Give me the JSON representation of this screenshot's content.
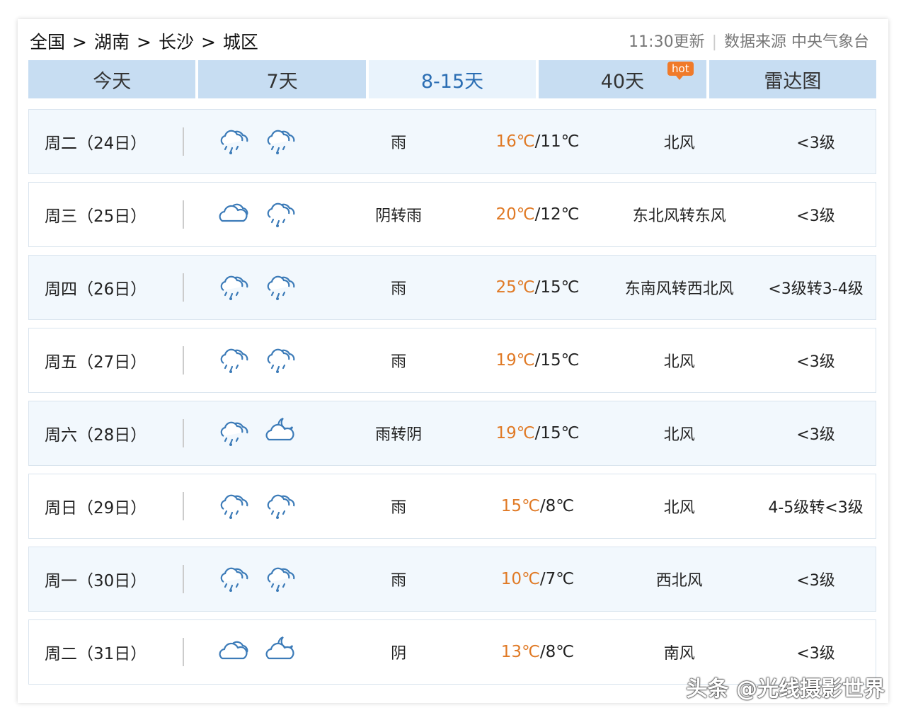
{
  "breadcrumb": {
    "items": [
      "全国",
      "湖南",
      "长沙",
      "城区"
    ],
    "separator": ">"
  },
  "source": {
    "update": "11:30更新",
    "divider": "|",
    "text": "数据来源 中央气象台"
  },
  "tabs": [
    {
      "label": "今天",
      "active": false
    },
    {
      "label": "7天",
      "active": false
    },
    {
      "label": "8-15天",
      "active": true
    },
    {
      "label": "40天",
      "active": false,
      "badge": "hot"
    },
    {
      "label": "雷达图",
      "active": false
    }
  ],
  "colors": {
    "tab_bg": "#c7ddf2",
    "tab_active_bg": "#e9f3fc",
    "tab_active_text": "#2a6db3",
    "high_temp": "#e07a26",
    "row_alt_bg": "#f2f8fd",
    "hot_badge": "#f07a2a",
    "icon": "#3c7bb8"
  },
  "forecast": [
    {
      "day": "周二（24日）",
      "icons": [
        "rain-cloud-icon",
        "rain-cloud-icon"
      ],
      "condition": "雨",
      "high": "16℃",
      "low": "11℃",
      "wind": "北风",
      "level": "<3级"
    },
    {
      "day": "周三（25日）",
      "icons": [
        "cloudy-icon",
        "rain-cloud-icon"
      ],
      "condition": "阴转雨",
      "high": "20℃",
      "low": "12℃",
      "wind": "东北风转东风",
      "level": "<3级"
    },
    {
      "day": "周四（26日）",
      "icons": [
        "rain-cloud-icon",
        "rain-cloud-icon"
      ],
      "condition": "雨",
      "high": "25℃",
      "low": "15℃",
      "wind": "东南风转西北风",
      "level": "<3级转3-4级"
    },
    {
      "day": "周五（27日）",
      "icons": [
        "rain-cloud-icon",
        "rain-cloud-icon"
      ],
      "condition": "雨",
      "high": "19℃",
      "low": "15℃",
      "wind": "北风",
      "level": "<3级"
    },
    {
      "day": "周六（28日）",
      "icons": [
        "rain-cloud-icon",
        "moon-cloud-icon"
      ],
      "condition": "雨转阴",
      "high": "19℃",
      "low": "15℃",
      "wind": "北风",
      "level": "<3级"
    },
    {
      "day": "周日（29日）",
      "icons": [
        "rain-cloud-icon",
        "rain-cloud-icon"
      ],
      "condition": "雨",
      "high": "15℃",
      "low": "8℃",
      "wind": "北风",
      "level": "4-5级转<3级"
    },
    {
      "day": "周一（30日）",
      "icons": [
        "rain-cloud-icon",
        "rain-cloud-icon"
      ],
      "condition": "雨",
      "high": "10℃",
      "low": "7℃",
      "wind": "西北风",
      "level": "<3级"
    },
    {
      "day": "周二（31日）",
      "icons": [
        "cloudy-icon",
        "moon-cloud-icon"
      ],
      "condition": "阴",
      "high": "13℃",
      "low": "8℃",
      "wind": "南风",
      "level": "<3级"
    }
  ],
  "watermark": "头条 @光线摄影世界"
}
